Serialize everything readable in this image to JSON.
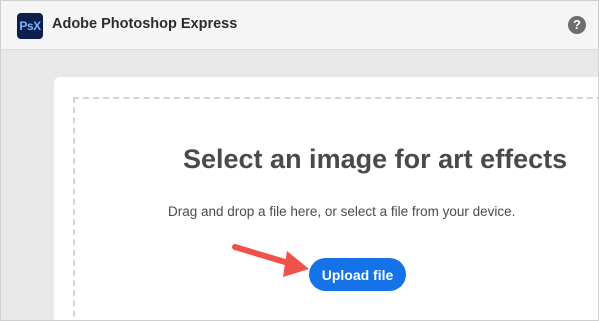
{
  "header": {
    "logo_text": "PsX",
    "app_title": "Adobe Photoshop Express",
    "help_icon": "question-circle-icon",
    "help_glyph": "?"
  },
  "main": {
    "headline": "Select an image for art effects",
    "subtext": "Drag and drop a file here, or select a file from your device.",
    "upload_button_label": "Upload file"
  },
  "colors": {
    "accent": "#1473e6",
    "logo_bg": "#0c1f4a",
    "annotation_arrow": "#f0524a"
  }
}
